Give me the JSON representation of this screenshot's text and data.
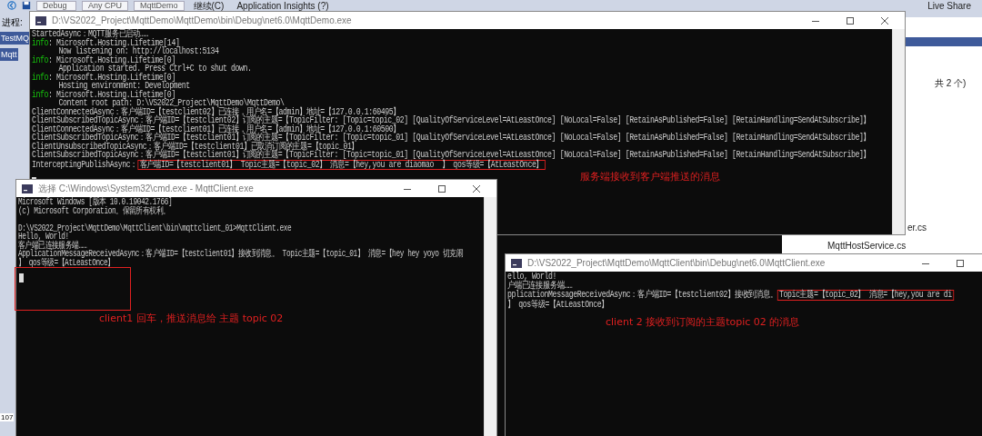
{
  "ide": {
    "toolbar": [
      {
        "kind": "dropdown",
        "label": "Debug"
      },
      {
        "kind": "dropdown",
        "label": "Any CPU"
      },
      {
        "kind": "dropdown",
        "label": "MqttDemo"
      },
      {
        "kind": "button",
        "label": "继续(C)"
      },
      {
        "kind": "button",
        "label": "Application Insights (?)"
      }
    ],
    "live_share": "Live Share",
    "process_label": "进程:",
    "left_tabs": [
      "TestMQ",
      "Mqtt"
    ],
    "line_number": "107",
    "panel_status": "共 2 个)",
    "files": [
      "er.cs",
      "MqttHostService.cs"
    ]
  },
  "windows": [
    {
      "title": "D:\\VS2022_Project\\MqttDemo\\MqttDemo\\bin\\Debug\\net6.0\\MqttDemo.exe",
      "lines": [
        {
          "kind": "plain",
          "text": "StartedAsync：MQTT服务已启动……"
        },
        {
          "kind": "info",
          "tag": "info",
          "text": ": Microsoft.Hosting.Lifetime[14]"
        },
        {
          "kind": "detail",
          "text": "Now listening on: http://localhost:5134"
        },
        {
          "kind": "info",
          "tag": "info",
          "text": ": Microsoft.Hosting.Lifetime[0]"
        },
        {
          "kind": "detail",
          "text": "Application started. Press Ctrl+C to shut down."
        },
        {
          "kind": "info",
          "tag": "info",
          "text": ": Microsoft.Hosting.Lifetime[0]"
        },
        {
          "kind": "detail",
          "text": "Hosting environment: Development"
        },
        {
          "kind": "info",
          "tag": "info",
          "text": ": Microsoft.Hosting.Lifetime[0]"
        },
        {
          "kind": "detail",
          "text": "Content root path: D:\\VS2022_Project\\MqttDemo\\MqttDemo\\"
        },
        {
          "kind": "plain",
          "text": "ClientConnectedAsync：客户端ID=【testclient02】已连接，用户名=【admin】地址=【127.0.0.1:60495】"
        },
        {
          "kind": "plain",
          "text": "ClientSubscribedTopicAsync：客户端ID=【testclient02】订阅的主题=【TopicFilter: [Topic=topic_02] [QualityOfServiceLevel=AtLeastOnce] [NoLocal=False] [RetainAsPublished=False] [RetainHandling=SendAtSubscribe]】"
        },
        {
          "kind": "plain",
          "text": "ClientConnectedAsync：客户端ID=【testclient01】已连接，用户名=【admin】地址=【127.0.0.1:60500】"
        },
        {
          "kind": "plain",
          "text": "ClientSubscribedTopicAsync：客户端ID=【testclient01】订阅的主题=【TopicFilter: [Topic=topic_01] [QualityOfServiceLevel=AtLeastOnce] [NoLocal=False] [RetainAsPublished=False] [RetainHandling=SendAtSubscribe]】"
        },
        {
          "kind": "plain",
          "text": "ClientUnsubscribedTopicAsync：客户端ID=【testclient01】已取消订阅的主题=【topic_01】"
        },
        {
          "kind": "plain",
          "text": "ClientSubscribedTopicAsync：客户端ID=【testclient01】订阅的主题=【TopicFilter: [Topic=topic_01] [QualityOfServiceLevel=AtLeastOnce] [NoLocal=False] [RetainAsPublished=False] [RetainHandling=SendAtSubscribe]】"
        },
        {
          "kind": "highlight",
          "text": "InterceptingPublishAsync：",
          "highlight": "客户端ID=【testclient01】 Topic主题=【topic_02】 消息=【hey,you are diaomao  】 qos等级=【AtLeastOnce】"
        },
        {
          "kind": "cursor"
        }
      ],
      "annotation": "服务端接收到客户端推送的消息"
    },
    {
      "title": "选择 C:\\Windows\\System32\\cmd.exe - MqttClient.exe",
      "lines": [
        {
          "kind": "plain",
          "text": "Microsoft Windows [版本 10.0.19042.1766]"
        },
        {
          "kind": "plain",
          "text": "(c) Microsoft Corporation。保留所有权利。"
        },
        {
          "kind": "blank"
        },
        {
          "kind": "plain",
          "text": "D:\\VS2022_Project\\MqttDemo\\MqttClient\\bin\\mqttclient_01>MqttClient.exe"
        },
        {
          "kind": "plain",
          "text": "Hello, World!"
        },
        {
          "kind": "plain",
          "text": "客户端已连接服务端……"
        },
        {
          "kind": "plain",
          "text": "ApplicationMessageReceivedAsync：客户端ID=【testclient01】接收到消息。 Topic主题=【topic_01】 消息=【hey hey yoyo 切克闹"
        },
        {
          "kind": "plain",
          "text": "】 qos等级=【AtLeastOnce】"
        },
        {
          "kind": "framed_cursor"
        }
      ],
      "annotation": "client1 回车，推送消息给 主题 topic 02"
    },
    {
      "title": "D:\\VS2022_Project\\MqttDemo\\MqttClient\\bin\\Debug\\net6.0\\MqttClient.exe",
      "lines": [
        {
          "kind": "plain",
          "text": "ello, World!"
        },
        {
          "kind": "plain",
          "text": "户端已连接服务端……"
        },
        {
          "kind": "highlight",
          "text": "pplicationMessageReceivedAsync：客户端ID=【testclient02】接收到消息。",
          "highlight": "Topic主题=【topic_02】 消息=【hey,you are di"
        },
        {
          "kind": "plain",
          "text": "】 qos等级=【AtLeastOnce】"
        }
      ],
      "annotation": "client 2 接收到订阅的主题topic 02 的消息"
    }
  ]
}
